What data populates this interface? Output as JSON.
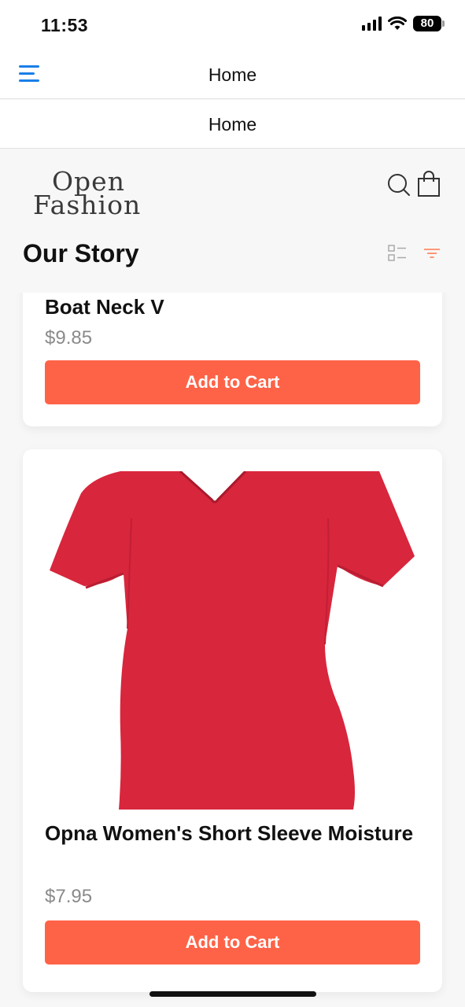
{
  "status_bar": {
    "time": "11:53",
    "battery": "80"
  },
  "nav": {
    "title": "Home"
  },
  "sub_nav": {
    "title": "Home"
  },
  "brand": {
    "logo_line1": "Open",
    "logo_line2": "Fashion"
  },
  "section": {
    "title": "Our Story"
  },
  "products": [
    {
      "name": "Boat Neck V",
      "price": "$9.85",
      "button_label": "Add to Cart"
    },
    {
      "name": "Opna Women's Short Sleeve Moisture",
      "price": "$7.95",
      "button_label": "Add to Cart",
      "image": "red-vneck-tshirt"
    }
  ],
  "colors": {
    "accent": "#ff6347",
    "menu_icon": "#1a7fe8",
    "filter_icon": "#ff8a65",
    "tshirt": "#d8263c"
  },
  "icons": {
    "menu": "hamburger-menu-icon",
    "search": "search-icon",
    "bag": "shopping-bag-icon",
    "list_view": "list-view-icon",
    "filter": "filter-icon"
  }
}
